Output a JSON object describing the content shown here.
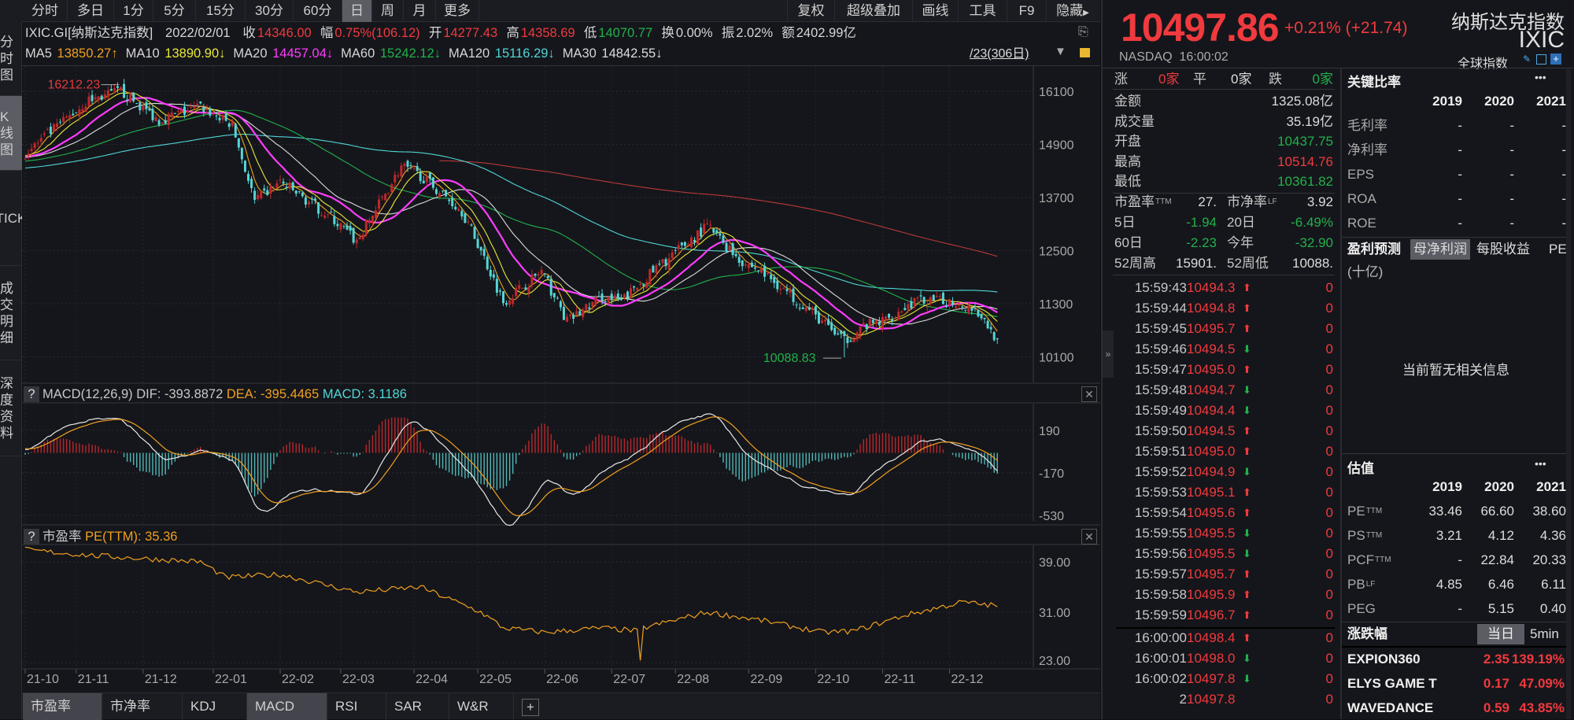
{
  "toolbar": {
    "periods": [
      "分时",
      "多日",
      "1分",
      "5分",
      "15分",
      "30分",
      "60分",
      "日",
      "周",
      "月",
      "更多"
    ],
    "selected": "日",
    "tools": [
      "复权",
      "超级叠加",
      "画线",
      "工具",
      "F9",
      "隐藏"
    ]
  },
  "left_tabs": [
    "分时图",
    "K线图",
    "TICK",
    "成交明细",
    "深度资料"
  ],
  "info": {
    "symbol": "IXIC.GI[纳斯达克指数]",
    "date": "2022/02/01",
    "close_label": "收",
    "close": "14346.00",
    "change_label": "幅",
    "change": "0.75%(106.12)",
    "open_label": "开",
    "open": "14277.43",
    "high_label": "高",
    "high": "14358.69",
    "low_label": "低",
    "low": "14070.77",
    "turnover_label": "换",
    "turnover": "0.00%",
    "amplitude_label": "振",
    "amplitude": "2.02%",
    "amount_label": "额",
    "amount": "2402.99亿"
  },
  "ma": [
    {
      "name": "MA5",
      "value": "13850.27↑",
      "color": "#f0a020"
    },
    {
      "name": "MA10",
      "value": "13890.90↓",
      "color": "#e8e83a"
    },
    {
      "name": "MA20",
      "value": "14457.04↓",
      "color": "#ff3cff"
    },
    {
      "name": "MA60",
      "value": "15242.12↓",
      "color": "#22b14c"
    },
    {
      "name": "MA120",
      "value": "15116.29↓",
      "color": "#4fd6d6"
    },
    {
      "name": "MA30",
      "value": "14842.55↓",
      "color": "#dcdcdc"
    }
  ],
  "range_label": "/23(306日)",
  "annotations": {
    "high": "16212.23",
    "low": "10088.83"
  },
  "macd_header": {
    "title": "MACD(12,26,9)",
    "dif": "DIF: -393.8872",
    "dea": "DEA: -395.4465",
    "macd": "MACD: 3.1186"
  },
  "pe_header": {
    "title": "市盈率",
    "value": "PE(TTM): 35.36"
  },
  "bottom_tabs": [
    "市盈率",
    "市净率",
    "KDJ",
    "MACD",
    "RSI",
    "SAR",
    "W&R",
    "+"
  ],
  "bottom_selected": [
    "市盈率",
    "MACD"
  ],
  "chart_data": {
    "type": "candlestick",
    "bars": 306,
    "price_ticks": [
      16100,
      14900,
      13700,
      12500,
      11300,
      10100
    ],
    "macd_ticks": [
      190,
      -170,
      -530
    ],
    "pe_ticks": [
      "39.00",
      "31.00",
      "23.00"
    ],
    "months": [
      {
        "label": "21-10",
        "bar": 0
      },
      {
        "label": "21-11",
        "bar": 16
      },
      {
        "label": "21-12",
        "bar": 37
      },
      {
        "label": "22-01",
        "bar": 59
      },
      {
        "label": "22-02",
        "bar": 80
      },
      {
        "label": "22-03",
        "bar": 99
      },
      {
        "label": "22-04",
        "bar": 122
      },
      {
        "label": "22-05",
        "bar": 142
      },
      {
        "label": "22-06",
        "bar": 163
      },
      {
        "label": "22-07",
        "bar": 184
      },
      {
        "label": "22-08",
        "bar": 204
      },
      {
        "label": "22-09",
        "bar": 227
      },
      {
        "label": "22-10",
        "bar": 248
      },
      {
        "label": "22-11",
        "bar": 269
      },
      {
        "label": "22-12",
        "bar": 290
      }
    ],
    "close_path": [
      [
        0,
        14700
      ],
      [
        20,
        15900
      ],
      [
        30,
        16100
      ],
      [
        42,
        15450
      ],
      [
        55,
        15750
      ],
      [
        65,
        15330
      ],
      [
        72,
        13600
      ],
      [
        80,
        14050
      ],
      [
        96,
        13250
      ],
      [
        104,
        12700
      ],
      [
        118,
        14400
      ],
      [
        124,
        14200
      ],
      [
        137,
        13400
      ],
      [
        143,
        12500
      ],
      [
        150,
        11350
      ],
      [
        162,
        12030
      ],
      [
        170,
        10900
      ],
      [
        181,
        11450
      ],
      [
        187,
        11350
      ],
      [
        197,
        12030
      ],
      [
        214,
        13050
      ],
      [
        225,
        12250
      ],
      [
        231,
        12030
      ],
      [
        241,
        11450
      ],
      [
        250,
        10900
      ],
      [
        257,
        10450
      ],
      [
        263,
        10790
      ],
      [
        269,
        10900
      ],
      [
        279,
        11350
      ],
      [
        291,
        11350
      ],
      [
        298,
        11200
      ],
      [
        305,
        10497
      ]
    ],
    "pre_history_start": 13300,
    "high_mark": {
      "bar": 30,
      "value": 16212.23
    },
    "low_mark": {
      "bar": 257,
      "value": 10088.83
    },
    "pe_path": [
      [
        0,
        40.9
      ],
      [
        21,
        40
      ],
      [
        55,
        39
      ],
      [
        63,
        36.5
      ],
      [
        80,
        37
      ],
      [
        104,
        34.2
      ],
      [
        124,
        35
      ],
      [
        143,
        31
      ],
      [
        150,
        28.5
      ],
      [
        163,
        27.8
      ],
      [
        181,
        28.5
      ],
      [
        192,
        28
      ],
      [
        193,
        23
      ],
      [
        194,
        28.5
      ],
      [
        214,
        31
      ],
      [
        231,
        29.7
      ],
      [
        250,
        27.8
      ],
      [
        260,
        28
      ],
      [
        276,
        30.5
      ],
      [
        294,
        32.6
      ],
      [
        305,
        32
      ]
    ],
    "ma_colors": {
      "ma5": "#f0a020",
      "ma10": "#e8e83a",
      "ma20": "#ff3cff",
      "ma30": "#dcdcdc",
      "ma60": "#22b14c",
      "ma120": "#4fd6d6",
      "ma250": "#b83a3a"
    },
    "up_color": "#c0282c",
    "down_color": "#54d6d6",
    "dif_color": "#e8e8e8",
    "dea_color": "#f0a020",
    "pe_color": "#f0a020"
  },
  "quote": {
    "price": "10497.86",
    "change": "+0.21% (+21.74)",
    "name_cn": "纳斯达克指数",
    "code": "IXIC",
    "exchange": "NASDAQ",
    "time": "16:00:02",
    "category": "全球指数",
    "breadth": {
      "up_label": "涨",
      "up": "0家",
      "flat_label": "平",
      "flat": "0家",
      "down_label": "跌",
      "down": "0家"
    },
    "stats": [
      {
        "label": "金额",
        "value": "1325.08亿",
        "color": "#dcdcdc"
      },
      {
        "label": "成交量",
        "value": "35.19亿",
        "color": "#dcdcdc"
      },
      {
        "label": "开盘",
        "value": "10437.75",
        "color": "#22b14c"
      },
      {
        "label": "最高",
        "value": "10514.76",
        "color": "#f03a3e"
      },
      {
        "label": "最低",
        "value": "10361.82",
        "color": "#22b14c"
      }
    ],
    "ratios": [
      {
        "l1": "市盈率",
        "s1": "TTM",
        "v1": "27.",
        "c1": "#dcdcdc",
        "l2": "市净率",
        "s2": "LF",
        "v2": "3.92",
        "c2": "#dcdcdc"
      },
      {
        "l1": "5日",
        "s1": "",
        "v1": "-1.94",
        "c1": "#22b14c",
        "l2": "20日",
        "s2": "",
        "v2": "-6.49%",
        "c2": "#22b14c"
      },
      {
        "l1": "60日",
        "s1": "",
        "v1": "-2.23",
        "c1": "#22b14c",
        "l2": "今年",
        "s2": "",
        "v2": "-32.90",
        "c2": "#22b14c"
      },
      {
        "l1": "52周高",
        "s1": "",
        "v1": "15901.",
        "c1": "#dcdcdc",
        "l2": "52周低",
        "s2": "",
        "v2": "10088.",
        "c2": "#dcdcdc"
      }
    ]
  },
  "ticks": [
    [
      "15:59:43",
      "10494.3",
      "up",
      "0"
    ],
    [
      "15:59:44",
      "10494.8",
      "up",
      "0"
    ],
    [
      "15:59:45",
      "10495.7",
      "up",
      "0"
    ],
    [
      "15:59:46",
      "10494.5",
      "down",
      "0"
    ],
    [
      "15:59:47",
      "10495.0",
      "up",
      "0"
    ],
    [
      "15:59:48",
      "10494.7",
      "down",
      "0"
    ],
    [
      "15:59:49",
      "10494.4",
      "down",
      "0"
    ],
    [
      "15:59:50",
      "10494.5",
      "up",
      "0"
    ],
    [
      "15:59:51",
      "10495.0",
      "up",
      "0"
    ],
    [
      "15:59:52",
      "10494.9",
      "down",
      "0"
    ],
    [
      "15:59:53",
      "10495.1",
      "up",
      "0"
    ],
    [
      "15:59:54",
      "10495.6",
      "up",
      "0"
    ],
    [
      "15:59:55",
      "10495.5",
      "down",
      "0"
    ],
    [
      "15:59:56",
      "10495.5",
      "down",
      "0"
    ],
    [
      "15:59:57",
      "10495.7",
      "up",
      "0"
    ],
    [
      "15:59:58",
      "10495.9",
      "up",
      "0"
    ],
    [
      "15:59:59",
      "10496.7",
      "up",
      "0"
    ],
    [
      "16:00:00",
      "10498.4",
      "up",
      "0"
    ],
    [
      "16:00:01",
      "10498.0",
      "down",
      "0"
    ],
    [
      "16:00:02",
      "10497.8",
      "down",
      "0"
    ],
    [
      "2",
      "10497.8",
      "",
      "0"
    ]
  ],
  "key_ratios": {
    "title": "关键比率",
    "more": "•••",
    "years": [
      "2019",
      "2020",
      "2021"
    ],
    "rows": [
      {
        "label": "毛利率",
        "v": [
          "-",
          "-",
          "-"
        ]
      },
      {
        "label": "净利率",
        "v": [
          "-",
          "-",
          "-"
        ]
      },
      {
        "label": "EPS",
        "v": [
          "-",
          "-",
          "-"
        ]
      },
      {
        "label": "ROA",
        "v": [
          "-",
          "-",
          "-"
        ]
      },
      {
        "label": "ROE",
        "v": [
          "-",
          "-",
          "-"
        ]
      }
    ]
  },
  "forecast": {
    "title": "盈利预测",
    "tabs": [
      "母净利润",
      "每股收益",
      "PE"
    ],
    "unit": "(十亿)",
    "empty": "当前暂无相关信息"
  },
  "valuation": {
    "title": "估值",
    "more": "•••",
    "years": [
      "2019",
      "2020",
      "2021"
    ],
    "rows": [
      {
        "label": "PE",
        "sub": "TTM",
        "v": [
          "33.46",
          "66.60",
          "38.60"
        ]
      },
      {
        "label": "PS",
        "sub": "TTM",
        "v": [
          "3.21",
          "4.12",
          "4.36"
        ]
      },
      {
        "label": "PCF",
        "sub": "TTM",
        "v": [
          "-",
          "22.84",
          "20.33"
        ]
      },
      {
        "label": "PB",
        "sub": "LF",
        "v": [
          "4.85",
          "6.46",
          "6.11"
        ]
      },
      {
        "label": "PEG",
        "sub": "",
        "v": [
          "-",
          "5.15",
          "0.40"
        ]
      }
    ]
  },
  "movers": {
    "title": "涨跌幅",
    "tabs": [
      "当日",
      "5min"
    ],
    "rows": [
      {
        "name": "EXPION360",
        "price": "2.35",
        "pct": "139.19%"
      },
      {
        "name": "ELYS GAME T",
        "price": "0.17",
        "pct": "47.09%"
      },
      {
        "name": "WAVEDANCE",
        "price": "0.59",
        "pct": "43.85%"
      }
    ]
  }
}
